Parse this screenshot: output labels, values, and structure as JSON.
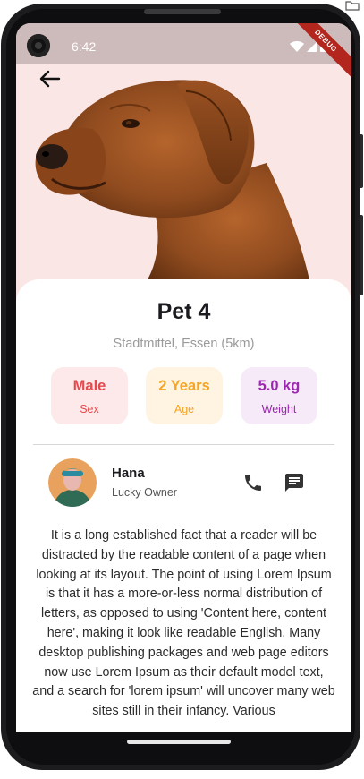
{
  "status_bar": {
    "time": "6:42",
    "debug_label": "DEBUG"
  },
  "pet": {
    "name": "Pet 4",
    "location": "Stadtmittel, Essen (5km)",
    "stats": [
      {
        "value": "Male",
        "label": "Sex",
        "color": "#e5484d",
        "bg": "#fde9e9"
      },
      {
        "value": "2 Years",
        "label": "Age",
        "color": "#f5a524",
        "bg": "#fff3e2"
      },
      {
        "value": "5.0 kg",
        "label": "Weight",
        "color": "#9c27b0",
        "bg": "#f6e9f8"
      }
    ]
  },
  "owner": {
    "name": "Hana",
    "role": "Lucky Owner"
  },
  "description": "It is a long established fact that a reader will be distracted by the readable content of a page when looking at its layout. The point of using Lorem Ipsum is that it has a more-or-less normal distribution of letters, as opposed to using 'Content here, content here', making it look like readable English. Many desktop publishing packages and web page editors now use Lorem Ipsum as their default model text, and a search for 'lorem ipsum' will uncover many web sites still in their infancy. Various",
  "icons": {
    "back": "arrow-left-icon",
    "call": "phone-icon",
    "message": "chat-icon"
  }
}
